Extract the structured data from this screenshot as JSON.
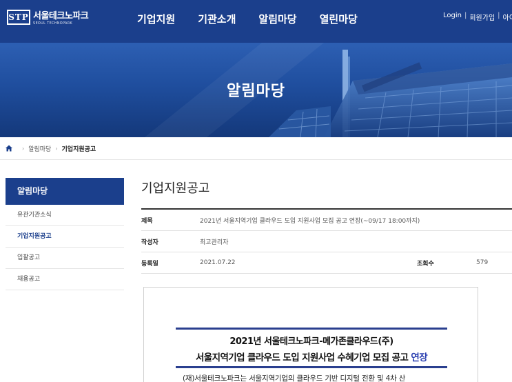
{
  "header": {
    "logo_mark": "STP",
    "logo_ko": "서울테크노파크",
    "logo_en": "SEOUL TECHNOPARK",
    "nav": [
      "기업지원",
      "기관소개",
      "알림마당",
      "열린마당"
    ],
    "util": {
      "login": "Login",
      "join": "회원가입",
      "id": "아이"
    }
  },
  "banner": {
    "title": "알림마당"
  },
  "breadcrumb": {
    "level1": "알림마당",
    "current": "기업지원공고"
  },
  "sidebar": {
    "title": "알림마당",
    "items": [
      "유관기관소식",
      "기업지원공고",
      "입찰공고",
      "채용공고"
    ]
  },
  "post": {
    "page_title": "기업지원공고",
    "labels": {
      "subject": "제목",
      "author": "작성자",
      "date": "등록일",
      "views": "조회수"
    },
    "subject": "2021년 서울지역기업 클라우드 도입 지원사업 모집 공고 연장(~09/17 18:00까지)",
    "author": "최고관리자",
    "date": "2021.07.22",
    "views": "579"
  },
  "poster": {
    "line1": "2021년 서울테크노파크-메가존클라우드(주)",
    "line2": "서울지역기업 클라우드 도입 지원사업 수혜기업 모집 공고",
    "line2_accent": "연장",
    "body": "(재)서울테크노파크는 서울지역기업의 클라우드 기반 디지털 전환 및 4차 산"
  },
  "colors": {
    "brand": "#1b3f8c",
    "accent": "#2a3fb0"
  }
}
